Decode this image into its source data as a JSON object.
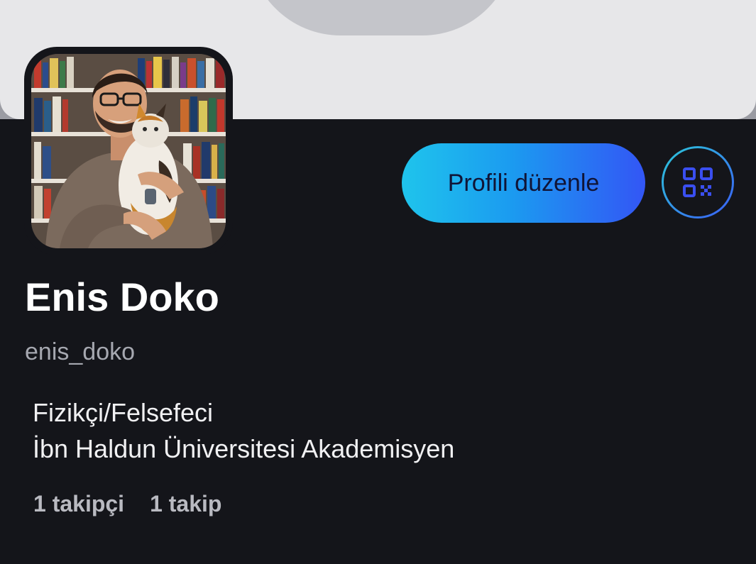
{
  "profile": {
    "name": "Enis Doko",
    "handle": "enis_doko",
    "bio_line_1": "Fizikçi/Felsefeci",
    "bio_line_2": "İbn Haldun Üniversitesi Akademisyen"
  },
  "actions": {
    "edit_profile_label": "Profili düzenle",
    "qr_icon": "qr-code-icon"
  },
  "stats": {
    "followers_count": "1",
    "followers_label": "takipçi",
    "following_count": "1",
    "following_label": "takip"
  },
  "colors": {
    "background": "#14151a",
    "accent_gradient_start": "#1fc4ec",
    "accent_gradient_end": "#3356f5",
    "qr_icon": "#3a4ff0"
  }
}
